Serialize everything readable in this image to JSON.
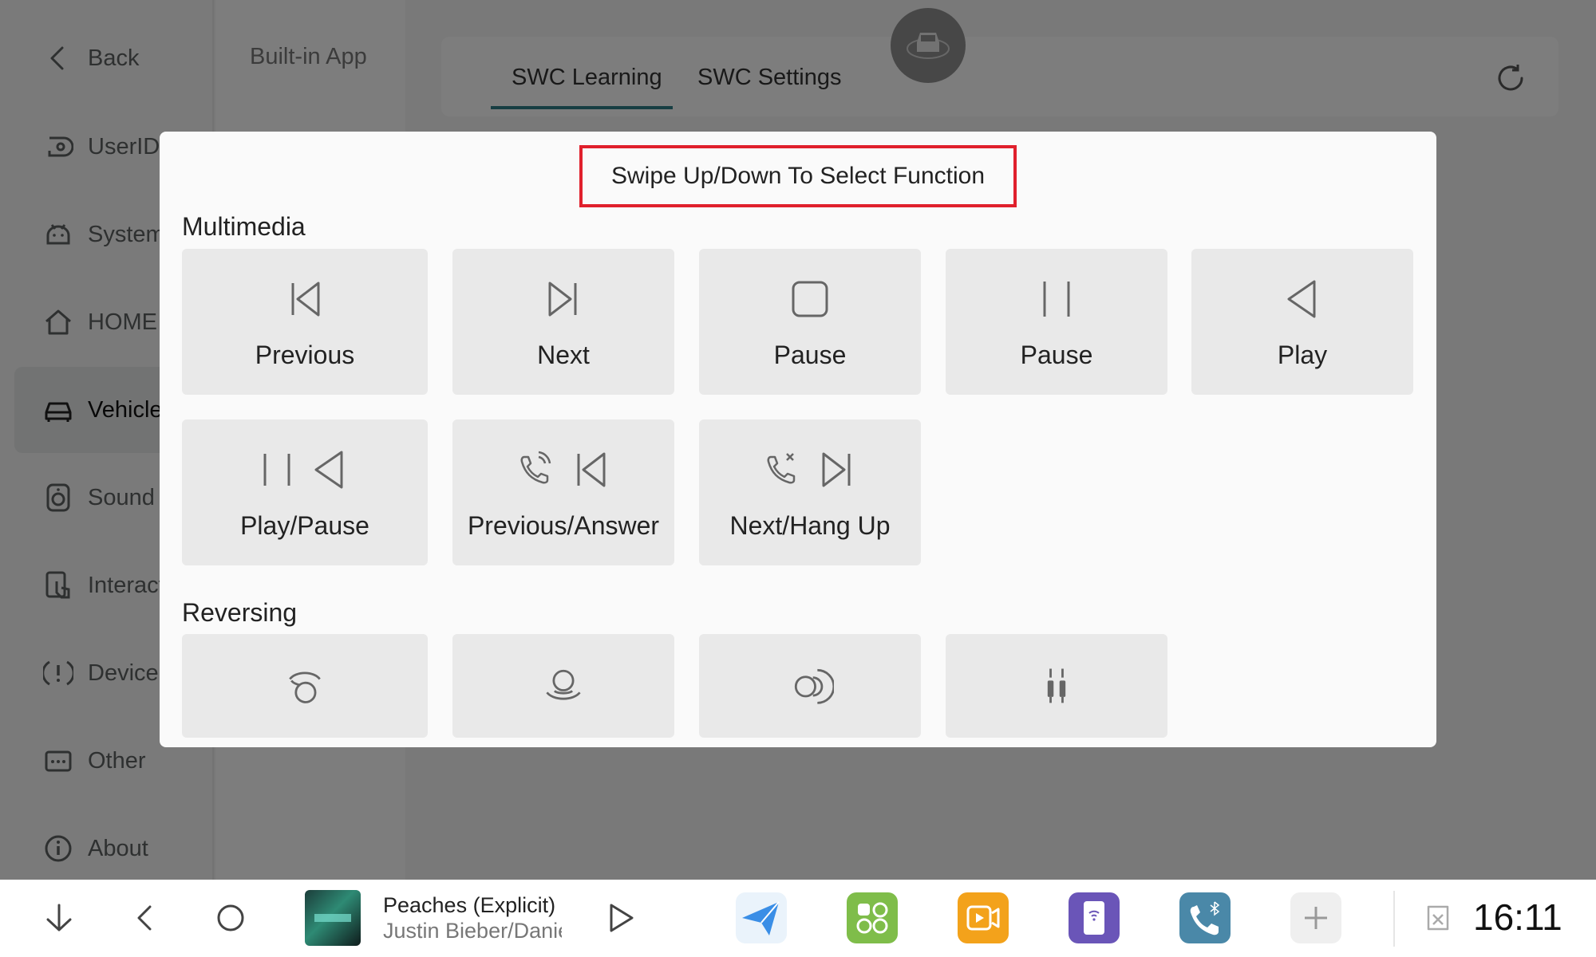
{
  "sidebar": {
    "items": [
      {
        "label": "Back",
        "icon": "chevron-left-icon"
      },
      {
        "label": "UserID",
        "icon": "user-id-icon"
      },
      {
        "label": "System",
        "icon": "android-icon"
      },
      {
        "label": "HOME",
        "icon": "home-icon"
      },
      {
        "label": "Vehicle",
        "icon": "car-icon",
        "active": true
      },
      {
        "label": "Sound",
        "icon": "speaker-icon"
      },
      {
        "label": "Interact",
        "icon": "touch-icon"
      },
      {
        "label": "Device",
        "icon": "alert-icon"
      },
      {
        "label": "Other",
        "icon": "more-icon"
      },
      {
        "label": "About",
        "icon": "info-icon"
      }
    ]
  },
  "subcolumn": {
    "item": "Built-in App"
  },
  "tabs": [
    {
      "label": "SWC Learning",
      "active": true
    },
    {
      "label": "SWC Settings"
    }
  ],
  "modal": {
    "hint": "Swipe Up/Down To Select Function",
    "sections": {
      "multimedia": "Multimedia",
      "reversing": "Reversing"
    },
    "multimedia_tiles": [
      {
        "label": "Previous",
        "icon": "skip-previous-icon"
      },
      {
        "label": "Next",
        "icon": "skip-next-icon"
      },
      {
        "label": "Pause",
        "icon": "stop-square-icon"
      },
      {
        "label": "Pause",
        "icon": "pause-icon"
      },
      {
        "label": "Play",
        "icon": "play-icon"
      },
      {
        "label": "Play/Pause",
        "icon": "play-pause-icon"
      },
      {
        "label": "Previous/Answer",
        "icon": "phone-answer-previous-icon"
      },
      {
        "label": "Next/Hang Up",
        "icon": "phone-hangup-next-icon"
      }
    ],
    "reversing_tiles": [
      {
        "icon": "camera-top-icon"
      },
      {
        "icon": "camera-front-icon"
      },
      {
        "icon": "camera-side-icon"
      },
      {
        "icon": "parking-sensor-icon"
      }
    ]
  },
  "media": {
    "title": "Peaches (Explicit)",
    "artist": "Justin Bieber/Daniel Caesar/Giveon"
  },
  "dock_apps": [
    {
      "icon": "navigation-app-icon",
      "color": "#3a8ee6"
    },
    {
      "icon": "apps-grid-icon",
      "color": "#7fbd4a"
    },
    {
      "icon": "video-app-icon",
      "color": "#f3a21b"
    },
    {
      "icon": "phone-link-app-icon",
      "color": "#6a55b8"
    },
    {
      "icon": "bluetooth-phone-app-icon",
      "color": "#4a88a8"
    },
    {
      "icon": "add-app-icon",
      "color": "#efefef"
    }
  ],
  "status": {
    "time": "16:11"
  },
  "colors": {
    "accent": "#2e7c86",
    "highlight_border": "#e0202c"
  }
}
